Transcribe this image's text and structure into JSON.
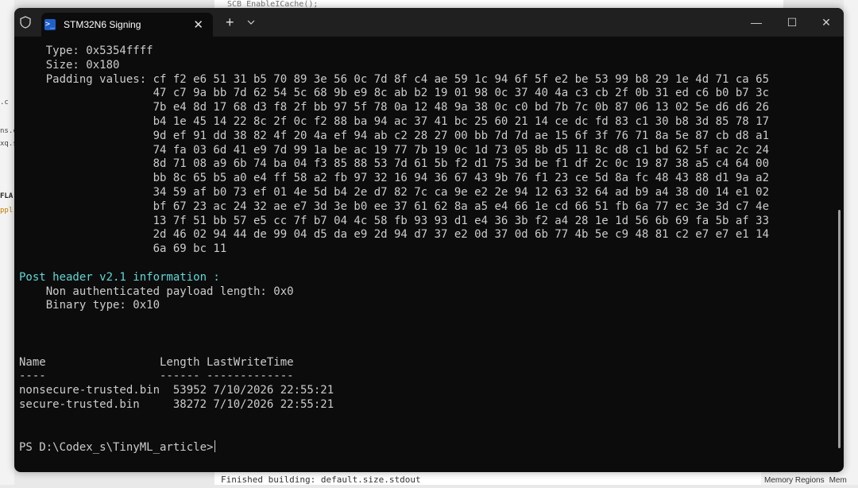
{
  "background": {
    "left_fragments": [
      ".c",
      "ns.c",
      "xq.s",
      "FLA",
      "ppl"
    ],
    "top_fragment": "SCB_EnableICache();",
    "bottom_fragment": "Finished building: default.size.stdout",
    "right_tabs": [
      "Memory Regions",
      "Mem"
    ]
  },
  "window": {
    "tab_title": "STM32N6 Signing",
    "tab_icon_glyph": ">_",
    "close_tab_glyph": "✕",
    "new_tab_glyph": "+",
    "minimize_glyph": "—",
    "maximize_glyph": "☐",
    "close_glyph": "✕"
  },
  "terminal": {
    "lines": [
      {
        "text": "    Type: 0x5354ffff",
        "color": "default"
      },
      {
        "text": "    Size: 0x180",
        "color": "default"
      },
      {
        "text": "    Padding values: cf f2 e6 51 31 b5 70 89 3e 56 0c 7d 8f c4 ae 59 1c 94 6f 5f e2 be 53 99 b8 29 1e 4d 71 ca 65",
        "color": "default"
      },
      {
        "text": "                    47 c7 9a bb 7d 62 54 5c 68 9b e9 8c ab b2 19 01 98 0c 37 40 4a c3 cb 2f 0b 31 ed c6 b0 b7 3c",
        "color": "default"
      },
      {
        "text": "                    7b e4 8d 17 68 d3 f8 2f bb 97 5f 78 0a 12 48 9a 38 0c c0 bd 7b 7c 0b 87 06 13 02 5e d6 d6 26",
        "color": "default"
      },
      {
        "text": "                    b4 1e 45 14 22 8c 2f 0c f2 88 ba 94 ac 37 41 bc 25 60 21 14 ce dc fd 83 c1 30 b8 3d 85 78 17",
        "color": "default"
      },
      {
        "text": "                    9d ef 91 dd 38 82 4f 20 4a ef 94 ab c2 28 27 00 bb 7d 7d ae 15 6f 3f 76 71 8a 5e 87 cb d8 a1",
        "color": "default"
      },
      {
        "text": "                    74 fa 03 6d 41 e9 7d 99 1a be ac 19 77 7b 19 0c 1d 73 05 8b d5 11 8c d8 c1 bd 62 5f ac 2c 24",
        "color": "default"
      },
      {
        "text": "                    8d 71 08 a9 6b 74 ba 04 f3 85 88 53 7d 61 5b f2 d1 75 3d be f1 df 2c 0c 19 87 38 a5 c4 64 00",
        "color": "default"
      },
      {
        "text": "                    bb 8c 65 b5 a0 e4 ff 58 a2 fb 97 32 16 94 36 67 43 9b 76 f1 23 ce 5d 8a fc 48 43 88 d1 9a a2",
        "color": "default"
      },
      {
        "text": "                    34 59 af b0 73 ef 01 4e 5d b4 2e d7 82 7c ca 9e e2 2e 94 12 63 32 64 ad b9 a4 38 d0 14 e1 02",
        "color": "default"
      },
      {
        "text": "                    bf 67 23 ac 24 32 ae e7 3d 3e b0 ee 37 61 62 8a a5 e4 66 1e cd 66 51 fb 6a 77 ec 3e 3d c7 4e",
        "color": "default"
      },
      {
        "text": "                    13 7f 51 bb 57 e5 cc 7f b7 04 4c 58 fb 93 93 d1 e4 36 3b f2 a4 28 1e 1d 56 6b 69 fa 5b af 33",
        "color": "default"
      },
      {
        "text": "                    2d 46 02 94 44 de 99 04 d5 da e9 2d 94 d7 37 e2 0d 37 0d 6b 77 4b 5e c9 48 81 c2 e7 e7 e1 14",
        "color": "default"
      },
      {
        "text": "                    6a 69 bc 11",
        "color": "default"
      },
      {
        "text": "",
        "color": "default"
      },
      {
        "text": "Post header v2.1 information :",
        "color": "cyan"
      },
      {
        "text": "    Non authenticated payload length: 0x0",
        "color": "default"
      },
      {
        "text": "    Binary type: 0x10",
        "color": "default"
      },
      {
        "text": "",
        "color": "default"
      },
      {
        "text": "",
        "color": "default"
      },
      {
        "text": "",
        "color": "default"
      },
      {
        "text": "Name                 Length LastWriteTime",
        "color": "default"
      },
      {
        "text": "----                 ------ -------------",
        "color": "default"
      },
      {
        "text": "nonsecure-trusted.bin  53952 7/10/2026 22:55:21",
        "color": "default"
      },
      {
        "text": "secure-trusted.bin     38272 7/10/2026 22:55:21",
        "color": "default"
      },
      {
        "text": "",
        "color": "default"
      },
      {
        "text": "",
        "color": "default"
      }
    ],
    "prompt": "PS D:\\Codex_s\\TinyML_article>"
  }
}
